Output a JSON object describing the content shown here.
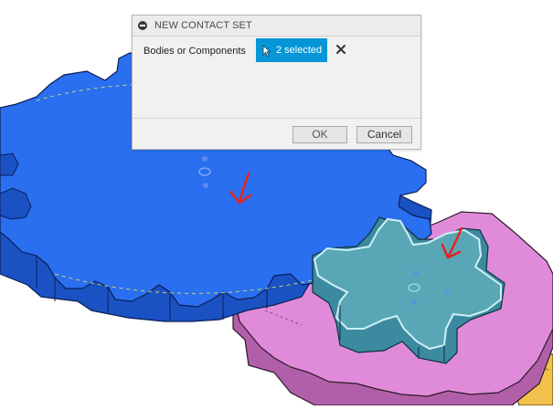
{
  "dialog": {
    "title": "NEW CONTACT SET",
    "field_label": "Bodies or Components",
    "selection_button_label": "2 selected",
    "ok_label": "OK",
    "cancel_label": "Cancel"
  },
  "icons": {
    "collapse": "minus-circle-icon",
    "selection_cursor": "arrow-cursor-icon",
    "clear_selection": "close-x-icon"
  },
  "colors": {
    "large_gear": "#1e64e6",
    "small_gear_selected": "#4aa0b8",
    "pink_gear": "#d77fd0",
    "selection_button": "#0696d7",
    "annotation_arrows": "#e8221c"
  }
}
